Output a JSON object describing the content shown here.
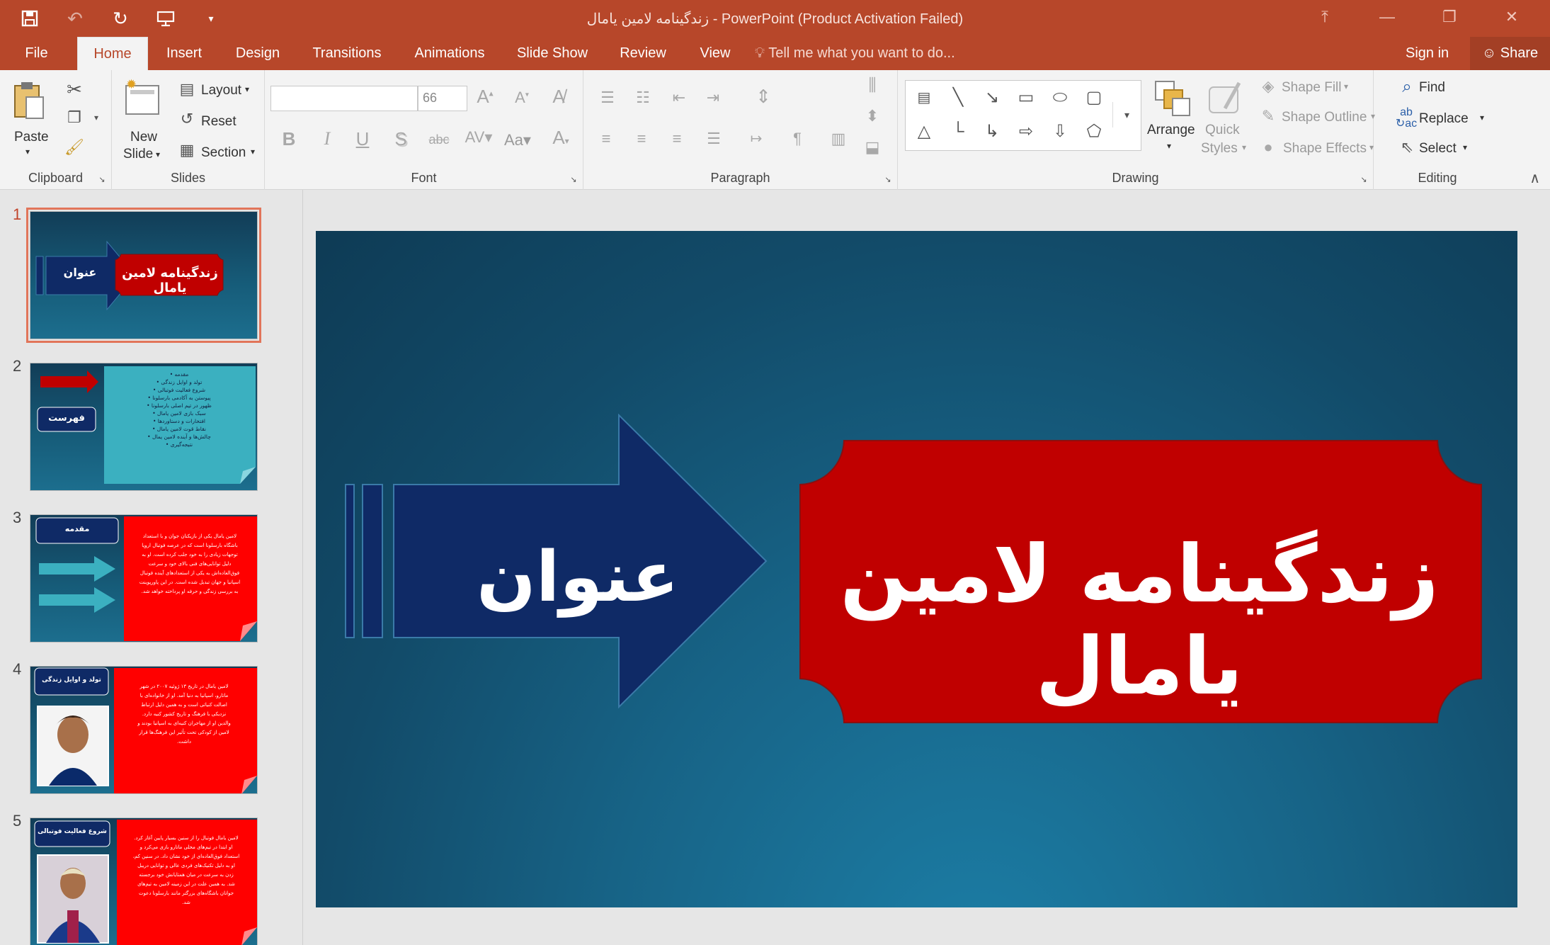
{
  "window": {
    "title": "زندگینامه لامین یامال - PowerPoint (Product Activation Failed)"
  },
  "qat": {
    "save_icon": "save-icon",
    "undo_icon": "undo-icon",
    "redo_icon": "repeat-icon",
    "present_icon": "start-from-beginning-icon",
    "customize_icon": "customize-qat-icon"
  },
  "tabs": [
    {
      "label": "File"
    },
    {
      "label": "Home"
    },
    {
      "label": "Insert"
    },
    {
      "label": "Design"
    },
    {
      "label": "Transitions"
    },
    {
      "label": "Animations"
    },
    {
      "label": "Slide Show"
    },
    {
      "label": "Review"
    },
    {
      "label": "View"
    }
  ],
  "tellme": "Tell me what you want to do...",
  "account": {
    "signin": "Sign in",
    "share": "Share"
  },
  "ribbon": {
    "clipboard": {
      "label": "Clipboard",
      "paste": "Paste"
    },
    "slides": {
      "label": "Slides",
      "new_slide_1": "New",
      "new_slide_2": "Slide",
      "layout": "Layout",
      "reset": "Reset",
      "section": "Section"
    },
    "font": {
      "label": "Font",
      "font_size": "66",
      "aa": "Aa"
    },
    "paragraph": {
      "label": "Paragraph"
    },
    "drawing": {
      "label": "Drawing",
      "arrange": "Arrange",
      "quick_1": "Quick",
      "quick_2": "Styles",
      "shape_fill": "Shape Fill",
      "shape_outline": "Shape Outline",
      "shape_effects": "Shape Effects"
    },
    "editing": {
      "label": "Editing",
      "find": "Find",
      "replace": "Replace",
      "select": "Select"
    }
  },
  "thumbnails": [
    {
      "num": "1",
      "arrow_label": "عنوان",
      "title": "زندگینامه لامین یامال"
    },
    {
      "num": "2",
      "title": "فهرست",
      "body": "مقدمه •\nتولد و اوایل زندگی •\nشروع فعالیت فوتبالی •\nپیوستن به آکادمی بارسلونا •\nظهور در تیم اصلی بارسلونا •\nسبک بازی لامین یامال •\nافتخارات و دستاوردها •\nنقاط قوت لامین یامال •\nچالش‌ها و آینده لامین یمال •\nنتیجه‌گیری •"
    },
    {
      "num": "3",
      "title": "مقدمه",
      "body": "لامین یامال یکی از بازیکنان جوان و با استعداد\nباشگاه بارسلونا است که در عرصه فوتبال اروپا\nتوجهات زیادی را به خود جلب کرده است. او به\nدلیل توانایی‌های فنی بالای خود و سرعت\nفوق‌العاده‌اش به یکی از استعدادهای آینده فوتبال\nاسپانیا و جهان تبدیل شده است. در این پاورپوینت\nبه بررسی زندگی و حرفه او پرداخته خواهد شد."
    },
    {
      "num": "4",
      "title": "تولد و اوایل زندگی",
      "body": "لامین یامال در تاریخ ۱۳ ژوئیه ۲۰۰۷ در شهر\nماتارو، اسپانیا به دنیا آمد. او از خانواده‌ای با\nاصالت کنیاتی است و به همین دلیل ارتباط\nنزدیکی با فرهنگ و تاریخ کشور کنیه دارد.\nوالدین او از مهاجران کنیه‌ای به اسپانیا بودند و\nلامین از کودکی تحت تأثیر این فرهنگ‌ها قرار\nداشت."
    },
    {
      "num": "5",
      "title": "شروع فعالیت فوتبالی",
      "body": "لامین یامال فوتبال را از سنین بسیار پایین آغاز کرد.\nاو ابتدا در تیم‌های محلی ماتارو بازی می‌کرد و\nاستعداد فوق‌العاده‌ای از خود نشان داد. در سنین کم،\nاو به دلیل تکنیک‌های فردی عالی و توانایی دریبل\nزدن به سرعت در میان همتایانش خود برجسته\nشد. به همین علت در این زمینه لامین به تیم‌های\nجوانان باشگاه‌های بزرگتر مانند بارسلونا دعوت\nشد."
    }
  ],
  "slide": {
    "arrow_label": "عنوان",
    "title": "زندگینامه لامین یامال"
  },
  "colors": {
    "accent": "#b7472a",
    "slide_red": "#c00000",
    "arrow_navy": "#0f2a66",
    "slide_teal": "#176386",
    "list_cyan": "#3bb0c0"
  }
}
